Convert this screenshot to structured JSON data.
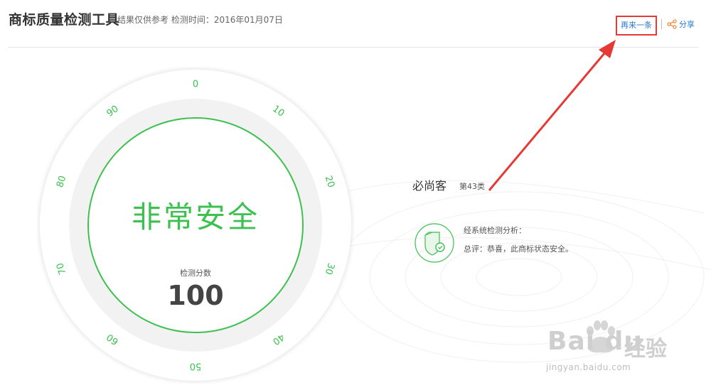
{
  "header": {
    "title": "商标质量检测工具",
    "subtitle": "结果仅供参考 检测时间：2016年01月07日",
    "again_label": "再来一条",
    "share_label": "分享"
  },
  "gauge": {
    "ticks": [
      "0",
      "10",
      "20",
      "30",
      "40",
      "50",
      "60",
      "70",
      "80",
      "90"
    ],
    "status": "非常安全",
    "score_label": "检测分数",
    "score": "100",
    "score_value": 100,
    "score_max": 100,
    "accent_color": "#3cc04f"
  },
  "result": {
    "brand": "必尚客",
    "class": "第43类",
    "analysis_title": "经系统检测分析：",
    "summary": "总评：恭喜，此商标状态安全。"
  },
  "watermark": {
    "main": "Bai du",
    "jingyan": "经验",
    "url": "jingyan.baidu.com"
  },
  "colors": {
    "accent": "#3cc04f",
    "link": "#2a7ad0",
    "highlight": "#e53935"
  },
  "icons": [
    "share-icon",
    "shield-icon",
    "arrow-annotation",
    "paw-icon"
  ]
}
